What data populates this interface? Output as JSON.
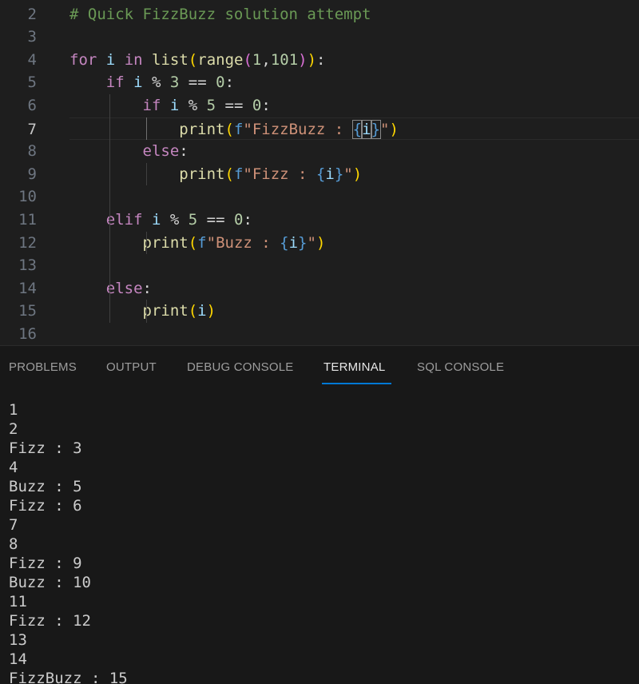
{
  "editor": {
    "active_line_number": "7",
    "lines": [
      {
        "number": "2",
        "tokens": [
          {
            "t": "# Quick FizzBuzz solution attempt",
            "c": "comment"
          }
        ]
      },
      {
        "number": "3",
        "tokens": []
      },
      {
        "number": "4",
        "tokens": [
          {
            "t": "for",
            "c": "keyword"
          },
          {
            "t": " ",
            "c": "default"
          },
          {
            "t": "i",
            "c": "var"
          },
          {
            "t": " ",
            "c": "default"
          },
          {
            "t": "in",
            "c": "keyword"
          },
          {
            "t": " ",
            "c": "default"
          },
          {
            "t": "list",
            "c": "func"
          },
          {
            "t": "(",
            "c": "paren1"
          },
          {
            "t": "range",
            "c": "func"
          },
          {
            "t": "(",
            "c": "paren2"
          },
          {
            "t": "1",
            "c": "num"
          },
          {
            "t": ",",
            "c": "default"
          },
          {
            "t": "101",
            "c": "num"
          },
          {
            "t": ")",
            "c": "paren2"
          },
          {
            "t": ")",
            "c": "paren1"
          },
          {
            "t": ":",
            "c": "default"
          }
        ]
      },
      {
        "number": "5",
        "tokens": [
          {
            "t": "    ",
            "c": "default"
          },
          {
            "t": "if",
            "c": "keyword"
          },
          {
            "t": " ",
            "c": "default"
          },
          {
            "t": "i",
            "c": "var"
          },
          {
            "t": " % ",
            "c": "op"
          },
          {
            "t": "3",
            "c": "num"
          },
          {
            "t": " == ",
            "c": "op"
          },
          {
            "t": "0",
            "c": "num"
          },
          {
            "t": ":",
            "c": "default"
          }
        ]
      },
      {
        "number": "6",
        "tokens": [
          {
            "t": "        ",
            "c": "default"
          },
          {
            "t": "if",
            "c": "keyword"
          },
          {
            "t": " ",
            "c": "default"
          },
          {
            "t": "i",
            "c": "var"
          },
          {
            "t": " % ",
            "c": "op"
          },
          {
            "t": "5",
            "c": "num"
          },
          {
            "t": " == ",
            "c": "op"
          },
          {
            "t": "0",
            "c": "num"
          },
          {
            "t": ":",
            "c": "default"
          }
        ]
      },
      {
        "number": "7",
        "tokens": [
          {
            "t": "            ",
            "c": "default"
          },
          {
            "t": "print",
            "c": "func"
          },
          {
            "t": "(",
            "c": "paren1"
          },
          {
            "t": "f",
            "c": "kw-blue"
          },
          {
            "t": "\"FizzBuzz : ",
            "c": "str"
          },
          {
            "t": "{",
            "c": "interp",
            "match": true
          },
          {
            "t": "i",
            "c": "var",
            "match": true
          },
          {
            "t": "}",
            "c": "interp",
            "match": true
          },
          {
            "t": "\"",
            "c": "str"
          },
          {
            "t": ")",
            "c": "paren1"
          }
        ]
      },
      {
        "number": "8",
        "tokens": [
          {
            "t": "        ",
            "c": "default"
          },
          {
            "t": "else",
            "c": "keyword"
          },
          {
            "t": ":",
            "c": "default"
          }
        ]
      },
      {
        "number": "9",
        "tokens": [
          {
            "t": "            ",
            "c": "default"
          },
          {
            "t": "print",
            "c": "func"
          },
          {
            "t": "(",
            "c": "paren1"
          },
          {
            "t": "f",
            "c": "kw-blue"
          },
          {
            "t": "\"Fizz : ",
            "c": "str"
          },
          {
            "t": "{",
            "c": "interp"
          },
          {
            "t": "i",
            "c": "var"
          },
          {
            "t": "}",
            "c": "interp"
          },
          {
            "t": "\"",
            "c": "str"
          },
          {
            "t": ")",
            "c": "paren1"
          }
        ]
      },
      {
        "number": "10",
        "tokens": []
      },
      {
        "number": "11",
        "tokens": [
          {
            "t": "    ",
            "c": "default"
          },
          {
            "t": "elif",
            "c": "keyword"
          },
          {
            "t": " ",
            "c": "default"
          },
          {
            "t": "i",
            "c": "var"
          },
          {
            "t": " % ",
            "c": "op"
          },
          {
            "t": "5",
            "c": "num"
          },
          {
            "t": " == ",
            "c": "op"
          },
          {
            "t": "0",
            "c": "num"
          },
          {
            "t": ":",
            "c": "default"
          }
        ]
      },
      {
        "number": "12",
        "tokens": [
          {
            "t": "        ",
            "c": "default"
          },
          {
            "t": "print",
            "c": "func"
          },
          {
            "t": "(",
            "c": "paren1"
          },
          {
            "t": "f",
            "c": "kw-blue"
          },
          {
            "t": "\"Buzz : ",
            "c": "str"
          },
          {
            "t": "{",
            "c": "interp"
          },
          {
            "t": "i",
            "c": "var"
          },
          {
            "t": "}",
            "c": "interp"
          },
          {
            "t": "\"",
            "c": "str"
          },
          {
            "t": ")",
            "c": "paren1"
          }
        ]
      },
      {
        "number": "13",
        "tokens": []
      },
      {
        "number": "14",
        "tokens": [
          {
            "t": "    ",
            "c": "default"
          },
          {
            "t": "else",
            "c": "keyword"
          },
          {
            "t": ":",
            "c": "default"
          }
        ]
      },
      {
        "number": "15",
        "tokens": [
          {
            "t": "        ",
            "c": "default"
          },
          {
            "t": "print",
            "c": "func"
          },
          {
            "t": "(",
            "c": "paren1"
          },
          {
            "t": "i",
            "c": "var"
          },
          {
            "t": ")",
            "c": "paren1"
          }
        ]
      },
      {
        "number": "16",
        "tokens": []
      }
    ]
  },
  "panel": {
    "active_tab": "TERMINAL",
    "tabs": [
      {
        "label": "PROBLEMS"
      },
      {
        "label": "OUTPUT"
      },
      {
        "label": "DEBUG CONSOLE"
      },
      {
        "label": "TERMINAL"
      },
      {
        "label": "SQL CONSOLE"
      }
    ]
  },
  "terminal": {
    "lines": [
      "1",
      "2",
      "Fizz : 3",
      "4",
      "Buzz : 5",
      "Fizz : 6",
      "7",
      "8",
      "Fizz : 9",
      "Buzz : 10",
      "11",
      "Fizz : 12",
      "13",
      "14",
      "FizzBuzz : 15"
    ]
  },
  "colors": {
    "editor_background": "#1e1e1e",
    "panel_background": "#181818",
    "accent": "#0078d4",
    "comment": "#6a9955",
    "keyword": "#c586c0",
    "function": "#dcdcaa",
    "string": "#ce9178",
    "number": "#b5cea8",
    "variable": "#9cdcfe"
  }
}
